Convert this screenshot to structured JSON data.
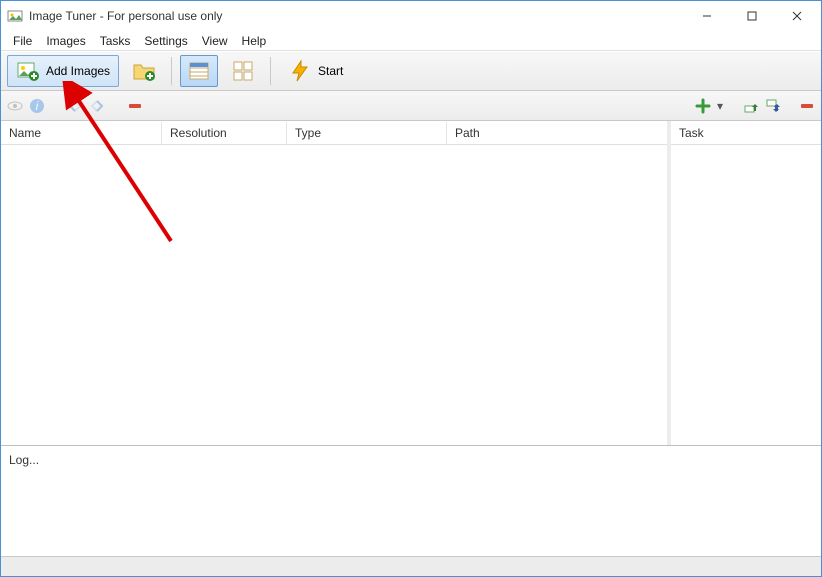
{
  "title": "Image Tuner - For personal use only",
  "menu": [
    "File",
    "Images",
    "Tasks",
    "Settings",
    "View",
    "Help"
  ],
  "toolbar": {
    "add_images": "Add Images",
    "start": "Start"
  },
  "columns": {
    "name": "Name",
    "resolution": "Resolution",
    "type": "Type",
    "path": "Path",
    "task": "Task"
  },
  "log_label": "Log...",
  "icons": {
    "app": "app-icon",
    "add_image": "add-image-icon",
    "add_folder": "add-folder-icon",
    "list": "list-view-icon",
    "thumbs": "thumbs-view-icon",
    "bolt": "lightning-icon",
    "eye": "eye-icon",
    "info": "info-icon",
    "rotate_l": "rotate-left-icon",
    "rotate_r": "rotate-right-icon",
    "remove": "remove-icon",
    "plus": "plus-icon",
    "up": "move-up-icon",
    "down": "move-down-icon"
  }
}
